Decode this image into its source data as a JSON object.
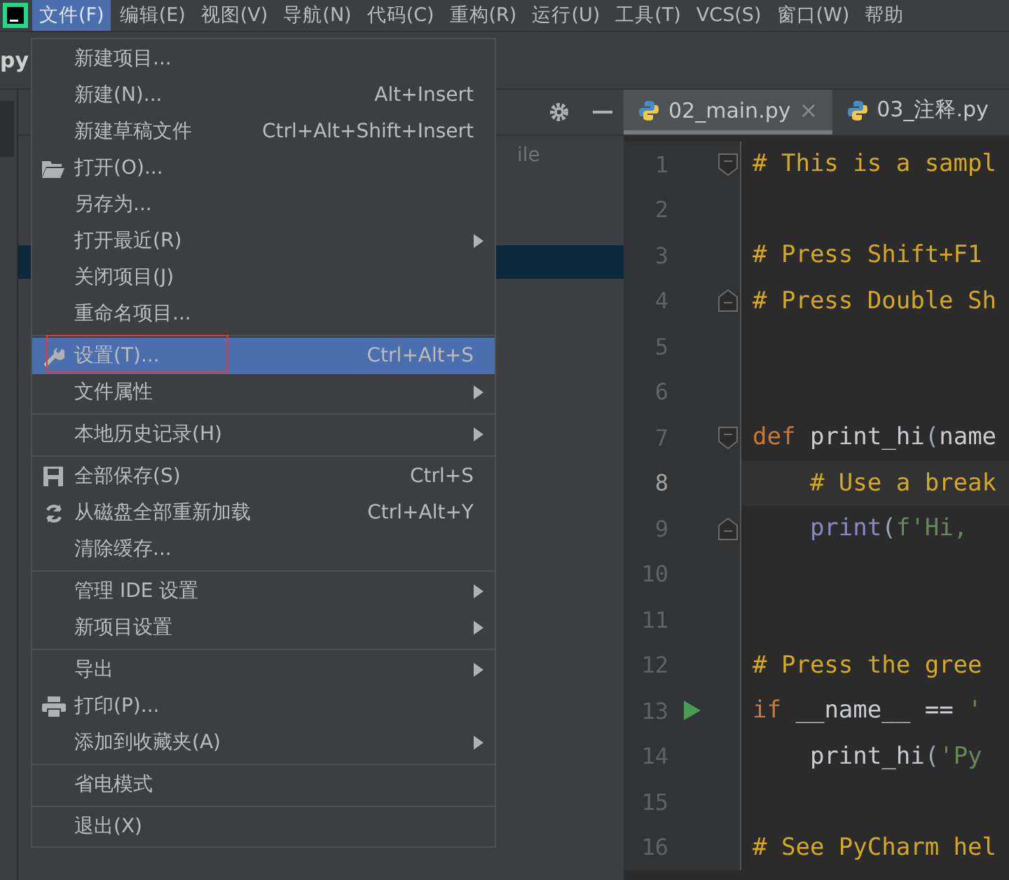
{
  "menu_bar": {
    "items": [
      {
        "label": "文件(F)",
        "selected": true
      },
      {
        "label": "编辑(E)",
        "selected": false
      },
      {
        "label": "视图(V)",
        "selected": false
      },
      {
        "label": "导航(N)",
        "selected": false
      },
      {
        "label": "代码(C)",
        "selected": false
      },
      {
        "label": "重构(R)",
        "selected": false
      },
      {
        "label": "运行(U)",
        "selected": false
      },
      {
        "label": "工具(T)",
        "selected": false
      },
      {
        "label": "VCS(S)",
        "selected": false
      },
      {
        "label": "窗口(W)",
        "selected": false
      },
      {
        "label": "帮助",
        "selected": false
      }
    ]
  },
  "project_title": "py",
  "project_panel": {
    "hint": "ile"
  },
  "file_menu": {
    "groups": [
      [
        {
          "label": "新建项目...",
          "selected": false
        },
        {
          "label": "新建(N)...",
          "shortcut": "Alt+Insert",
          "selected": false
        },
        {
          "label": "新建草稿文件",
          "shortcut": "Ctrl+Alt+Shift+Insert",
          "selected": false
        },
        {
          "label": "打开(O)...",
          "selected": false
        },
        {
          "label": "另存为...",
          "selected": false
        },
        {
          "label": "打开最近(R)",
          "submenu": true,
          "selected": false
        },
        {
          "label": "关闭项目(J)",
          "selected": false
        },
        {
          "label": "重命名项目...",
          "selected": false
        }
      ],
      [
        {
          "label": "设置(T)...",
          "shortcut": "Ctrl+Alt+S",
          "selected": true,
          "annotated": true
        },
        {
          "label": "文件属性",
          "submenu": true,
          "selected": false
        }
      ],
      [
        {
          "label": "本地历史记录(H)",
          "submenu": true,
          "selected": false
        }
      ],
      [
        {
          "label": "全部保存(S)",
          "shortcut": "Ctrl+S",
          "selected": false
        },
        {
          "label": "从磁盘全部重新加载",
          "shortcut": "Ctrl+Alt+Y",
          "selected": false
        },
        {
          "label": "清除缓存...",
          "selected": false
        }
      ],
      [
        {
          "label": "管理 IDE 设置",
          "submenu": true,
          "selected": false
        },
        {
          "label": "新项目设置",
          "submenu": true,
          "selected": false
        }
      ],
      [
        {
          "label": "导出",
          "submenu": true,
          "selected": false
        },
        {
          "label": "打印(P)...",
          "selected": false
        },
        {
          "label": "添加到收藏夹(A)",
          "submenu": true,
          "selected": false
        }
      ],
      [
        {
          "label": "省电模式",
          "selected": false
        }
      ],
      [
        {
          "label": "退出(X)",
          "selected": false
        }
      ]
    ]
  },
  "editor_tabs": [
    {
      "label": "02_main.py",
      "close": "×",
      "selected": true
    },
    {
      "label": "03_注释.py",
      "selected": false
    }
  ],
  "editor": {
    "lines": [
      {
        "number": "1",
        "fold_start": true,
        "tokens": [
          {
            "kind": "comment",
            "text": "# This is a sampl"
          }
        ]
      },
      {
        "number": "2"
      },
      {
        "number": "3",
        "tokens": [
          {
            "kind": "comment",
            "text": "# Press Shift+F1"
          }
        ]
      },
      {
        "number": "4",
        "fold_end": true,
        "tokens": [
          {
            "kind": "comment",
            "text": "# Press Double Sh"
          }
        ]
      },
      {
        "number": "5"
      },
      {
        "number": "6"
      },
      {
        "number": "7",
        "fold_start": true,
        "tokens": [
          {
            "kind": "keyword",
            "text": "def"
          },
          {
            "kind": "plain",
            "text": " print_hi"
          },
          {
            "kind": "paren",
            "text": "("
          },
          {
            "kind": "plain",
            "text": "name"
          }
        ]
      },
      {
        "number": "8",
        "current": true,
        "tokens": [
          {
            "kind": "comment",
            "text": "    # Use a break"
          }
        ]
      },
      {
        "number": "9",
        "fold_end": true,
        "tokens": [
          {
            "kind": "builtin",
            "text": "    print"
          },
          {
            "kind": "paren",
            "text": "("
          },
          {
            "kind": "string",
            "text": "f'Hi, "
          }
        ]
      },
      {
        "number": "10"
      },
      {
        "number": "11"
      },
      {
        "number": "12",
        "tokens": [
          {
            "kind": "comment",
            "text": "# Press the gree"
          }
        ]
      },
      {
        "number": "13",
        "run": true,
        "tokens": [
          {
            "kind": "keyword",
            "text": "if"
          },
          {
            "kind": "plain",
            "text": " __name__ == "
          },
          {
            "kind": "string",
            "text": "'"
          }
        ]
      },
      {
        "number": "14",
        "tokens": [
          {
            "kind": "plain",
            "text": "    print_hi"
          },
          {
            "kind": "paren",
            "text": "("
          },
          {
            "kind": "string",
            "text": "'Py"
          }
        ]
      },
      {
        "number": "15"
      },
      {
        "number": "16",
        "tokens": [
          {
            "kind": "comment",
            "text": "# See PyCharm hel"
          }
        ]
      }
    ]
  }
}
